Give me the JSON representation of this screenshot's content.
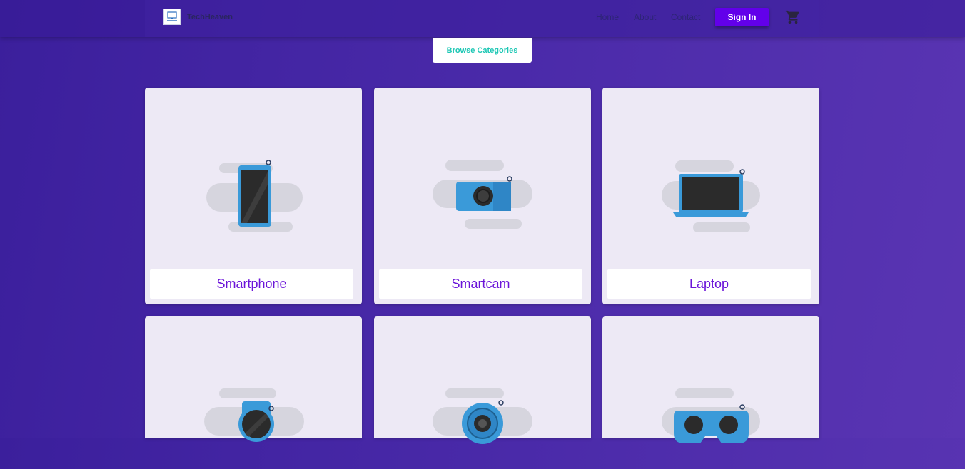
{
  "brand": {
    "logo_alt": "TechHeaven",
    "name": "TechHeaven"
  },
  "nav": {
    "links": [
      "Home",
      "About",
      "Contact"
    ],
    "signin_label": "Sign In",
    "cart_icon": "cart-icon"
  },
  "browse_label": "Browse Categories",
  "categories": [
    {
      "label": "Smartphone",
      "icon": "smartphone-icon"
    },
    {
      "label": "Smartcam",
      "icon": "smartcam-icon"
    },
    {
      "label": "Laptop",
      "icon": "laptop-icon"
    },
    {
      "label": "",
      "icon": "smartwatch-icon"
    },
    {
      "label": "",
      "icon": "webcam-icon"
    },
    {
      "label": "",
      "icon": "vr-headset-icon"
    }
  ],
  "colors": {
    "accent": "#6200ea",
    "label": "#6b14d9",
    "browse": "#1cc7b4",
    "device_blue": "#3a9ad9"
  }
}
